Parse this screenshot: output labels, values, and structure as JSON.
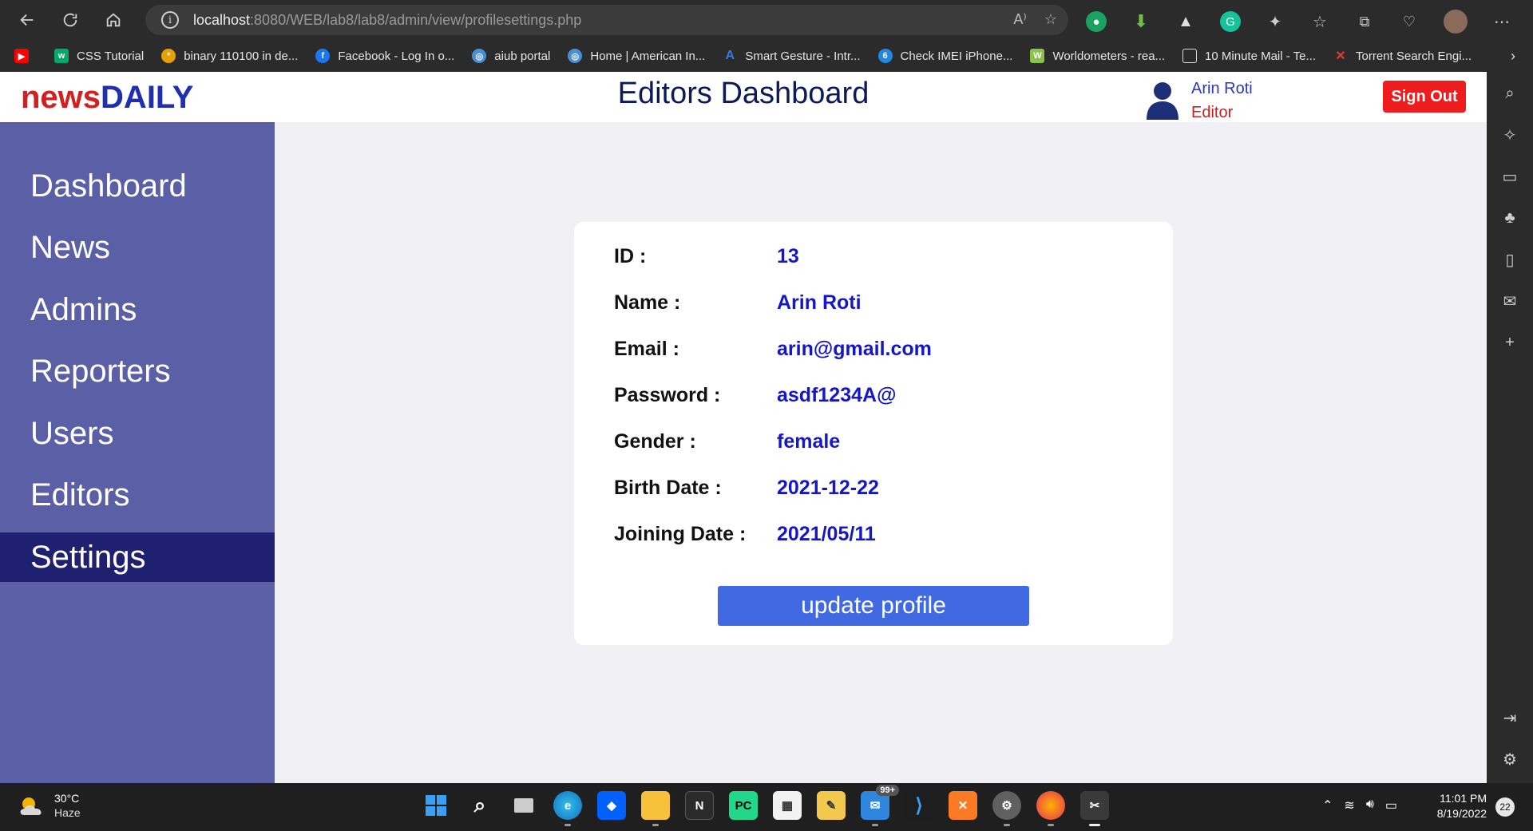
{
  "browser": {
    "url_host": "localhost",
    "url_path": ":8080/WEB/lab8/lab8/admin/view/profilesettings.php",
    "bookmarks": [
      {
        "label": "CSS Tutorial",
        "icon": "w3-icon",
        "color": "#04aa6d"
      },
      {
        "label": "binary 110100 in de...",
        "icon": "wolfram-icon",
        "color": "#e6a100"
      },
      {
        "label": "Facebook - Log In o...",
        "icon": "facebook-icon",
        "color": "#1877f2"
      },
      {
        "label": "aiub portal",
        "icon": "globe-icon",
        "color": "#4a8fd8"
      },
      {
        "label": "Home | American In...",
        "icon": "globe-icon",
        "color": "#4a8fd8"
      },
      {
        "label": "Smart Gesture - Intr...",
        "icon": "asus-icon",
        "color": "#2d7be5"
      },
      {
        "label": "Check IMEI iPhone...",
        "icon": "imei-icon",
        "color": "#1e88e5"
      },
      {
        "label": "Worldometers - rea...",
        "icon": "w-icon",
        "color": "#8bc34a"
      },
      {
        "label": "10 Minute Mail - Te...",
        "icon": "page-icon",
        "color": "#555555"
      },
      {
        "label": "Torrent Search Engi...",
        "icon": "x-icon",
        "color": "#e53935"
      }
    ]
  },
  "app": {
    "logo_part1": "news",
    "logo_part2": "DAILY",
    "title": "Editors Dashboard",
    "user_name": "Arin Roti",
    "user_role": "Editor",
    "signout_label": "Sign Out"
  },
  "sidebar": {
    "items": [
      {
        "label": "Dashboard",
        "active": false
      },
      {
        "label": "News",
        "active": false
      },
      {
        "label": "Admins",
        "active": false
      },
      {
        "label": "Reporters",
        "active": false
      },
      {
        "label": "Users",
        "active": false
      },
      {
        "label": "Editors",
        "active": false
      },
      {
        "label": "Settings",
        "active": true
      }
    ]
  },
  "profile": {
    "rows": [
      {
        "label": "ID :",
        "value": "13"
      },
      {
        "label": "Name :",
        "value": "Arin Roti"
      },
      {
        "label": "Email :",
        "value": "arin@gmail.com"
      },
      {
        "label": "Password :",
        "value": "asdf1234A@"
      },
      {
        "label": "Gender :",
        "value": "female"
      },
      {
        "label": "Birth Date :",
        "value": "2021-12-22"
      },
      {
        "label": "Joining Date :",
        "value": "2021/05/11"
      }
    ],
    "update_label": "update profile"
  },
  "taskbar": {
    "temperature": "30°C",
    "condition": "Haze",
    "time": "11:01 PM",
    "date": "8/19/2022",
    "notifications": "22",
    "mail_badge": "99+"
  }
}
